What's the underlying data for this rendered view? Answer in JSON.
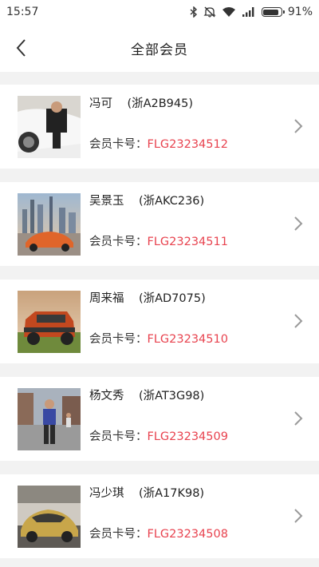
{
  "status_bar": {
    "time": "15:57",
    "battery_text": "91%",
    "battery_level": 0.91,
    "icons": [
      "bluetooth-icon",
      "mute-icon",
      "wifi-icon",
      "signal-icon",
      "battery-icon"
    ]
  },
  "header": {
    "title": "全部会员",
    "back_icon": "chevron-left-icon"
  },
  "card_label": "会员卡号：",
  "members": [
    {
      "name": "冯可",
      "plate": "(浙A2B945)",
      "card_no": "FLG23234512",
      "thumb": "white-car-man-photo"
    },
    {
      "name": "吴景玉",
      "plate": "(浙AKC236)",
      "card_no": "FLG23234511",
      "thumb": "orange-sports-car-city-photo"
    },
    {
      "name": "周来福",
      "plate": "(浙AD7075)",
      "card_no": "FLG23234510",
      "thumb": "red-suv-photo"
    },
    {
      "name": "杨文秀",
      "plate": "(浙AT3G98)",
      "card_no": "FLG23234509",
      "thumb": "man-in-street-photo"
    },
    {
      "name": "冯少琪",
      "plate": "(浙A17K98)",
      "card_no": "FLG23234508",
      "thumb": "gold-sports-car-photo"
    }
  ],
  "colors": {
    "accent": "#e8434f",
    "background": "#f2f2f2",
    "card": "#ffffff"
  }
}
